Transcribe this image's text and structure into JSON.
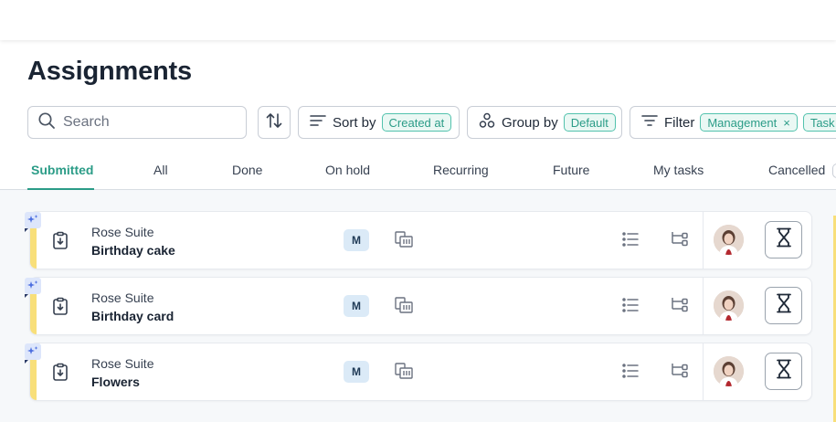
{
  "page": {
    "title": "Assignments"
  },
  "toolbar": {
    "search_placeholder": "Search",
    "sort_label": "Sort by",
    "sort_value": "Created at",
    "group_label": "Group by",
    "group_value": "Default",
    "filter_label": "Filter",
    "filter_pills": [
      "Management",
      "Task"
    ],
    "remove_glyph": "×"
  },
  "tabs": [
    "Submitted",
    "All",
    "Done",
    "On hold",
    "Recurring",
    "Future",
    "My tasks",
    "Cancelled"
  ],
  "active_tab": "Submitted",
  "rows": [
    {
      "location": "Rose Suite",
      "name": "Birthday cake",
      "badge": "M"
    },
    {
      "location": "Rose Suite",
      "name": "Birthday card",
      "badge": "M"
    },
    {
      "location": "Rose Suite",
      "name": "Flowers",
      "badge": "M"
    }
  ],
  "colors": {
    "accent": "#2b9c87",
    "priority_stripe": "#f8df7a",
    "badge_bg": "#dbeaf7",
    "ai_badge_bg": "#dde6fb"
  }
}
